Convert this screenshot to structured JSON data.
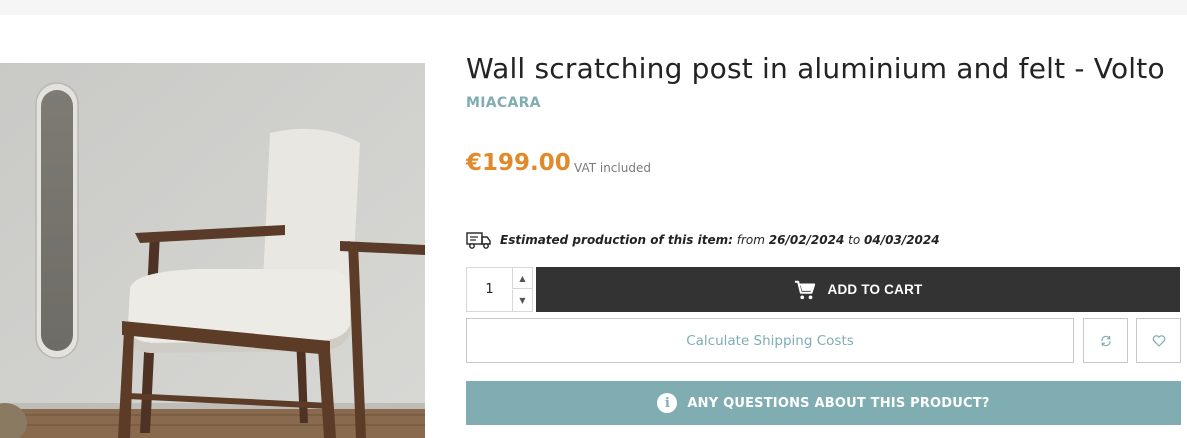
{
  "product": {
    "title": "Wall scratching post in aluminium and felt - Volto",
    "brand": "MIACARA",
    "price": "€199.00",
    "vat_note": "VAT included",
    "image_alt": "Wall scratching post next to an armchair"
  },
  "estimate": {
    "icon": "delivery-truck-icon",
    "label": "Estimated production of this item:",
    "from_word": "from",
    "from_date": "26/02/2024",
    "to_word": "to",
    "to_date": "04/03/2024"
  },
  "purchase": {
    "quantity": "1",
    "add_to_cart_label": "ADD TO CART",
    "cart_icon": "shopping-cart-icon"
  },
  "actions": {
    "shipping_label": "Calculate Shipping Costs",
    "compare_icon": "compare-icon",
    "wishlist_icon": "heart-icon",
    "questions_label": "ANY QUESTIONS ABOUT THIS PRODUCT?",
    "questions_icon": "info-icon"
  },
  "colors": {
    "accent": "#e08a2c",
    "teal": "#7fadb2",
    "dark_button": "#333333"
  }
}
